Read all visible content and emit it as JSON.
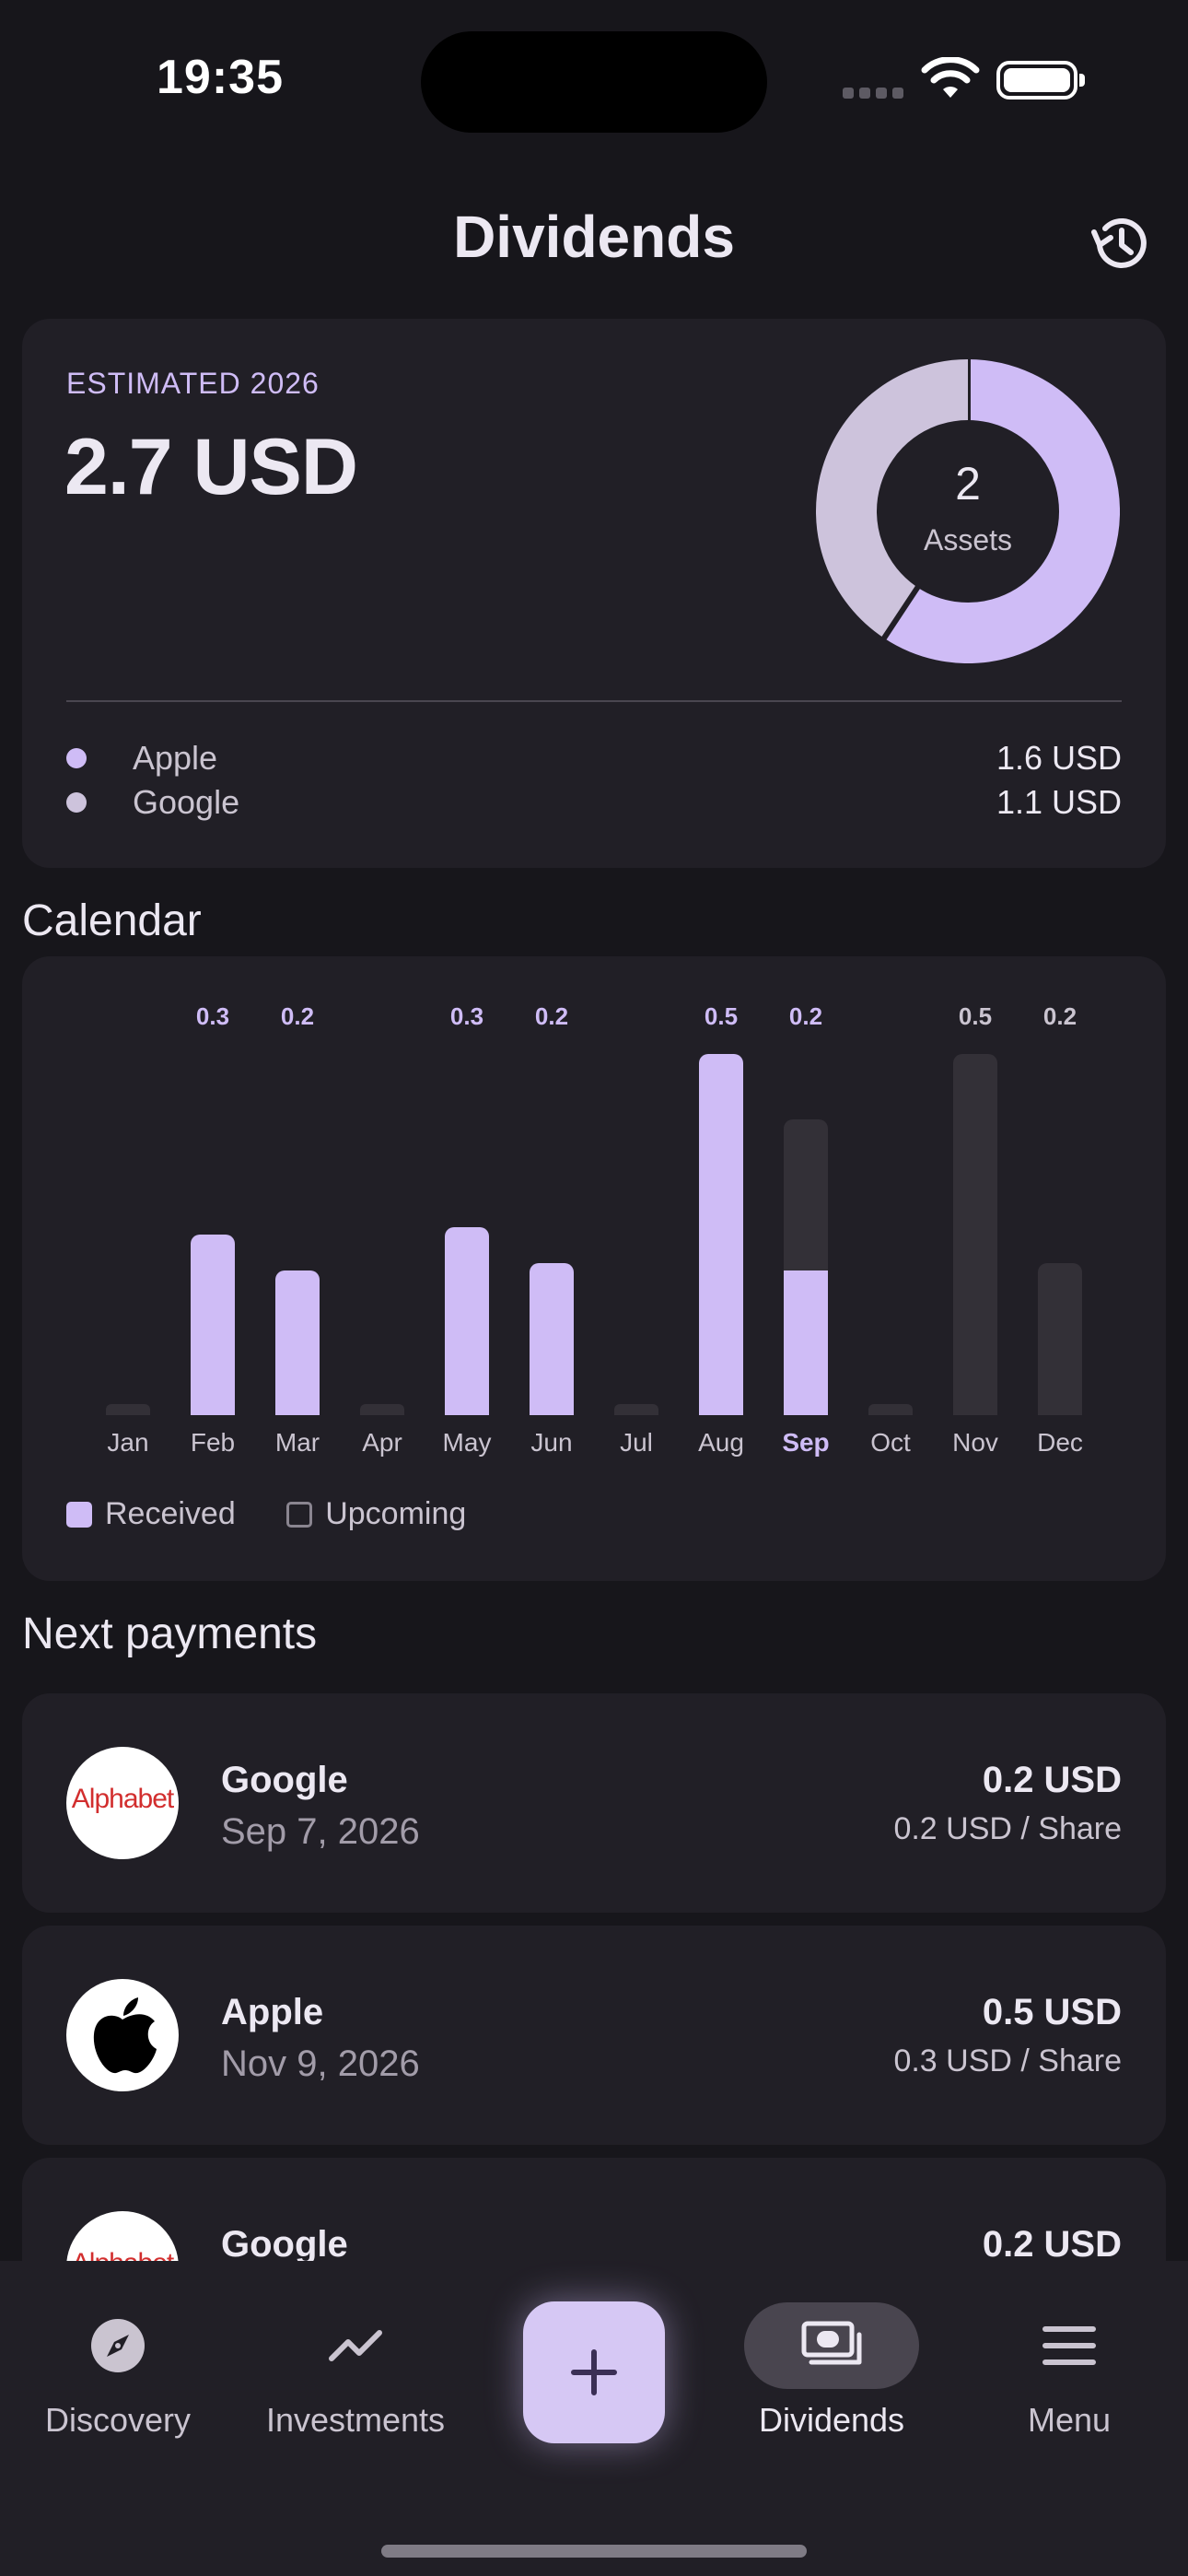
{
  "status_bar": {
    "time": "19:35"
  },
  "header": {
    "title": "Dividends"
  },
  "summary": {
    "label": "ESTIMATED 2026",
    "total": "2.7 USD",
    "asset_count": "2",
    "asset_label": "Assets",
    "holdings": [
      {
        "name": "Apple",
        "amount": "1.6 USD",
        "share": 0.593,
        "color": "#cfbcf6"
      },
      {
        "name": "Google",
        "amount": "1.1 USD",
        "share": 0.407,
        "color": "#cdc3dc"
      }
    ]
  },
  "calendar": {
    "title": "Calendar",
    "legend": {
      "received": "Received",
      "upcoming": "Upcoming"
    },
    "colors": {
      "received": "#cfbcf6",
      "upcoming": "#333037"
    }
  },
  "chart_data": {
    "type": "bar",
    "categories": [
      "Jan",
      "Feb",
      "Mar",
      "Apr",
      "May",
      "Jun",
      "Jul",
      "Aug",
      "Sep",
      "Oct",
      "Nov",
      "Dec"
    ],
    "series": [
      {
        "name": "Received",
        "values": [
          0,
          0.25,
          0.2,
          0,
          0.26,
          0.21,
          0,
          0.5,
          0.2,
          0,
          0,
          0
        ]
      },
      {
        "name": "Upcoming",
        "values": [
          0,
          0,
          0,
          0,
          0,
          0,
          0,
          0,
          0.21,
          0,
          0.5,
          0.21
        ]
      }
    ],
    "labels": [
      "",
      "0.3",
      "0.2",
      "",
      "0.3",
      "0.2",
      "",
      "0.5",
      "0.2",
      "",
      "0.5",
      "0.2"
    ],
    "highlighted_category": "Sep",
    "ylim": [
      0,
      0.5
    ],
    "grid": false,
    "legend_position": "bottom-left"
  },
  "next_payments": {
    "title": "Next payments",
    "items": [
      {
        "name": "Google",
        "date": "Sep 7, 2026",
        "amount": "0.2 USD",
        "per_share": "0.2 USD / Share",
        "logo": "alphabet-logo",
        "logo_text": "Alphabet"
      },
      {
        "name": "Apple",
        "date": "Nov 9, 2026",
        "amount": "0.5 USD",
        "per_share": "0.3 USD / Share",
        "logo": "apple-logo"
      },
      {
        "name": "Google",
        "amount": "0.2 USD",
        "logo": "alphabet-logo",
        "logo_text": "Alphabet"
      }
    ]
  },
  "nav": {
    "items": [
      {
        "label": "Discovery",
        "icon": "compass-icon"
      },
      {
        "label": "Investments",
        "icon": "trend-icon"
      },
      {
        "label": "Dividends",
        "icon": "cash-icon",
        "active": true
      },
      {
        "label": "Menu",
        "icon": "menu-icon"
      }
    ],
    "add_icon": "plus-icon"
  }
}
